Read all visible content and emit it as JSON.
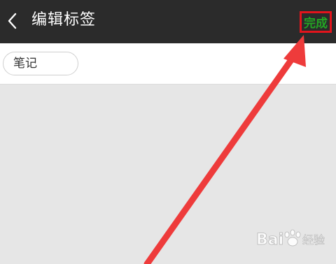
{
  "header": {
    "title": "编辑标签",
    "done_label": "完成",
    "back_icon": "chevron-left-icon"
  },
  "tags": [
    {
      "label": "笔记"
    }
  ],
  "annotation": {
    "highlight_color": "#e2141c",
    "arrow_color": "#ee3b3b"
  },
  "watermark": {
    "brand": "Bai",
    "suffix": "经验"
  },
  "colors": {
    "topbar": "#2b2b2b",
    "done_text": "#23a523",
    "background": "#e6e6e6"
  }
}
